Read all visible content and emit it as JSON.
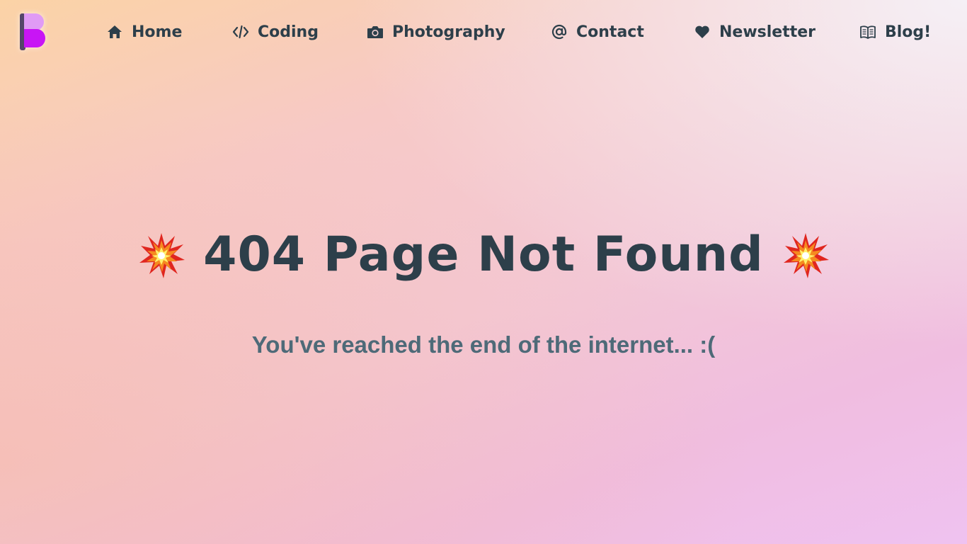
{
  "nav": {
    "items": [
      {
        "label": "Home",
        "icon": "home-icon"
      },
      {
        "label": "Coding",
        "icon": "code-icon"
      },
      {
        "label": "Photography",
        "icon": "camera-icon"
      },
      {
        "label": "Contact",
        "icon": "at-icon"
      },
      {
        "label": "Newsletter",
        "icon": "heart-icon"
      },
      {
        "label": "Blog!",
        "icon": "book-icon"
      }
    ]
  },
  "main": {
    "title": "404 Page Not Found",
    "subtitle": "You've reached the end of the internet... :(",
    "title_icon": "collision-emoji"
  },
  "colors": {
    "text_dark": "#2d3f4a",
    "text_muted": "#4e6a78",
    "logo_light": "#e09bf5",
    "logo_bright": "#c815f5",
    "logo_bar": "#55466a"
  }
}
